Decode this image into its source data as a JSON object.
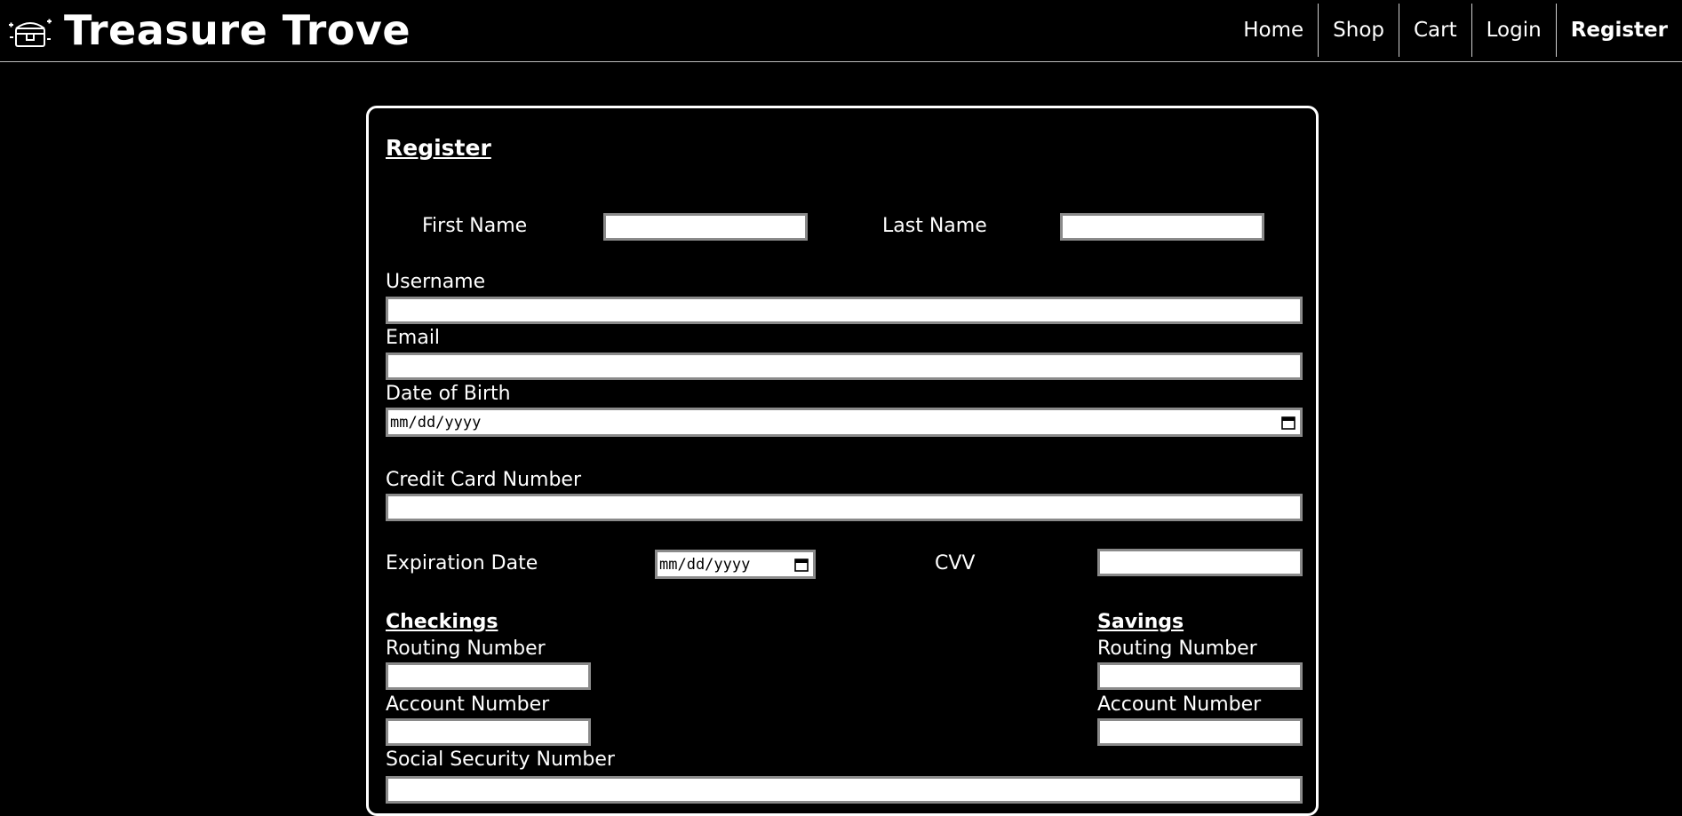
{
  "header": {
    "title": "Treasure Trove",
    "nav": [
      {
        "label": "Home",
        "active": false
      },
      {
        "label": "Shop",
        "active": false
      },
      {
        "label": "Cart",
        "active": false
      },
      {
        "label": "Login",
        "active": false
      },
      {
        "label": "Register",
        "active": true
      }
    ],
    "logo_icon": "treasure-chest-icon"
  },
  "form": {
    "title": "Register",
    "first_name_label": "First Name",
    "first_name_value": "",
    "last_name_label": "Last Name",
    "last_name_value": "",
    "username_label": "Username",
    "username_value": "",
    "email_label": "Email",
    "email_value": "",
    "dob_label": "Date of Birth",
    "dob_placeholder": "mm/dd/yyyy",
    "credit_card_label": "Credit Card Number",
    "credit_card_value": "",
    "expiration_label": "Expiration Date",
    "expiration_placeholder": "mm/dd/yyyy",
    "cvv_label": "CVV",
    "cvv_value": "",
    "checkings": {
      "heading": "Checkings",
      "routing_label": "Routing Number",
      "routing_value": "",
      "account_label": "Account Number",
      "account_value": ""
    },
    "savings": {
      "heading": "Savings",
      "routing_label": "Routing Number",
      "routing_value": "",
      "account_label": "Account Number",
      "account_value": ""
    },
    "ssn_label": "Social Security Number",
    "ssn_value": ""
  },
  "colors": {
    "background": "#000000",
    "text": "#ffffff",
    "input_border": "#8a8a8a"
  }
}
